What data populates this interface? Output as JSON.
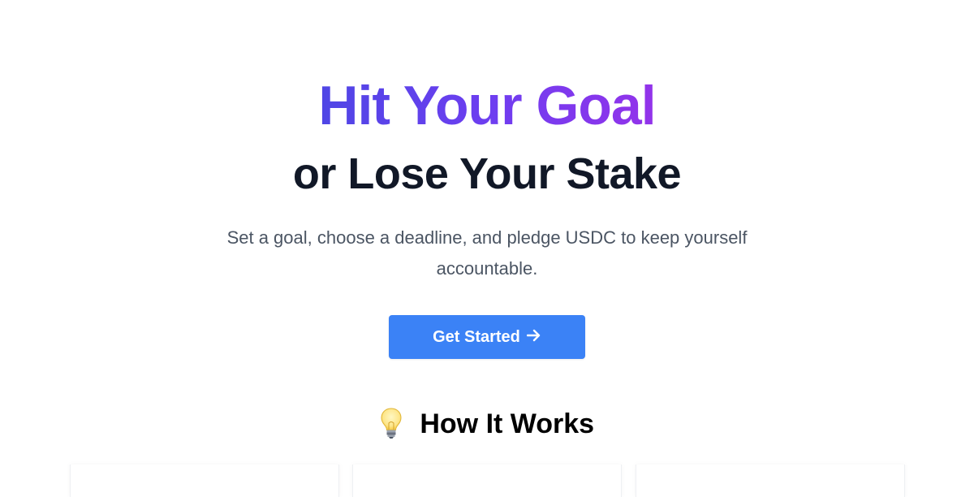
{
  "hero": {
    "headline_gradient": "Hit Your Goal",
    "headline_dark": "or Lose Your Stake",
    "subtitle": "Set a goal, choose a deadline, and pledge USDC to keep yourself accountable.",
    "cta_label": "Get Started",
    "cta_icon": "arrow-right-icon"
  },
  "how_it_works": {
    "heading": "How It Works",
    "icon": "lightbulb-icon",
    "cards": [
      {},
      {},
      {}
    ]
  },
  "colors": {
    "gradient_start": "#4f46e5",
    "gradient_end": "#9333ea",
    "cta_background": "#3b82f6",
    "heading_dark": "#111827",
    "subtitle_text": "#4b5563"
  }
}
